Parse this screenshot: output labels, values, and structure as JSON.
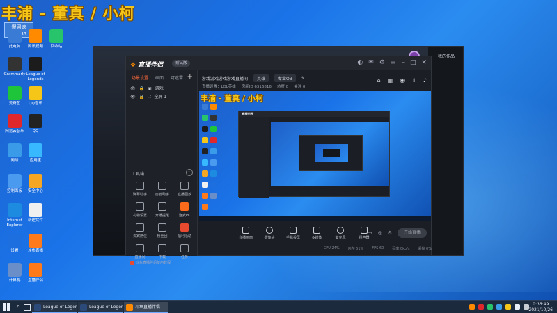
{
  "stream_overlay": {
    "title": "丰浦 - 董真 / 小柯",
    "user_badge": "慢网速",
    "user_id": "63185"
  },
  "desktop_icons": [
    {
      "label": "此电脑",
      "color": "#3a7bd5"
    },
    {
      "label": "腾讯视频",
      "color": "#ff8a00"
    },
    {
      "label": "回收站",
      "color": "#27c46b"
    },
    {
      "label": "Grammarly",
      "color": "#333"
    },
    {
      "label": "League of Legends",
      "color": "#1c1c1c"
    },
    {
      "label": "爱奇艺",
      "color": "#1ec43a"
    },
    {
      "label": "QQ音乐",
      "color": "#f5c518"
    },
    {
      "label": "网易云音乐",
      "color": "#e0282c"
    },
    {
      "label": "QQ",
      "color": "#222"
    },
    {
      "label": "网络",
      "color": "#3a9be8"
    },
    {
      "label": "应用宝",
      "color": "#37b8ff"
    },
    {
      "label": "控制面板",
      "color": "#4a9af0"
    },
    {
      "label": "安全中心",
      "color": "#f5a623"
    },
    {
      "label": "Internet Explorer",
      "color": "#1d8ce0"
    },
    {
      "label": "新建文件",
      "color": "#f0f0f0"
    },
    {
      "label": "设置",
      "color": "#1d6fe0"
    },
    {
      "label": "斗鱼直播",
      "color": "#ff7a1a"
    },
    {
      "label": "计算机",
      "color": "#6a8fc8"
    },
    {
      "label": "直播伴侣",
      "color": "#ff7a1a"
    }
  ],
  "obs_window": {
    "top_text": "我的作品"
  },
  "live_window": {
    "logo": "直播伴侣",
    "version": "测试版",
    "sidebar_tabs": [
      "场景设置",
      "画面",
      "可遮罩"
    ],
    "scenes": [
      {
        "label": "游戏"
      },
      {
        "label": "全屏 1"
      }
    ],
    "tools_label": "工具箱",
    "tools": [
      {
        "label": "弹幕助手",
        "style": ""
      },
      {
        "label": "房管助手",
        "style": ""
      },
      {
        "label": "直播回放",
        "style": ""
      },
      {
        "label": "礼物设置",
        "style": ""
      },
      {
        "label": "开播提醒",
        "style": ""
      },
      {
        "label": "连麦PK",
        "style": "orange"
      },
      {
        "label": "贵宾席位",
        "style": ""
      },
      {
        "label": "粉丝团",
        "style": ""
      },
      {
        "label": "福利活动",
        "style": "red"
      },
      {
        "label": "直播间",
        "style": ""
      },
      {
        "label": "下载",
        "style": ""
      },
      {
        "label": "任务",
        "style": ""
      }
    ],
    "footer_ad": "斗鱼直播伴侣使用教程",
    "room_title": "游戏游戏游戏游戏直播间",
    "room_tag": "英雄",
    "room_game": "专业OB",
    "room_info": [
      "直播设置：LOL英雄",
      "房间ID 6316816",
      "热度 0",
      "关注 0"
    ],
    "bottom_tools": [
      {
        "label": "直播画面",
        "round": false
      },
      {
        "label": "摄像头",
        "round": true
      },
      {
        "label": "手机投屏",
        "round": false
      },
      {
        "label": "多媒体",
        "round": false
      },
      {
        "label": "麦克风",
        "round": true
      },
      {
        "label": "扬声器",
        "round": false
      }
    ],
    "start_live": "开始直播",
    "status_items": [
      "CPU 24%",
      "内存 51%",
      "FPS 60",
      "码率 0kb/s",
      "丢帧 0%"
    ]
  },
  "taskbar": {
    "apps": [
      "League of Legends",
      "League of Legends",
      "斗鱼直播伴侣"
    ],
    "time": "0:36:49",
    "date": "2021/10/26"
  }
}
